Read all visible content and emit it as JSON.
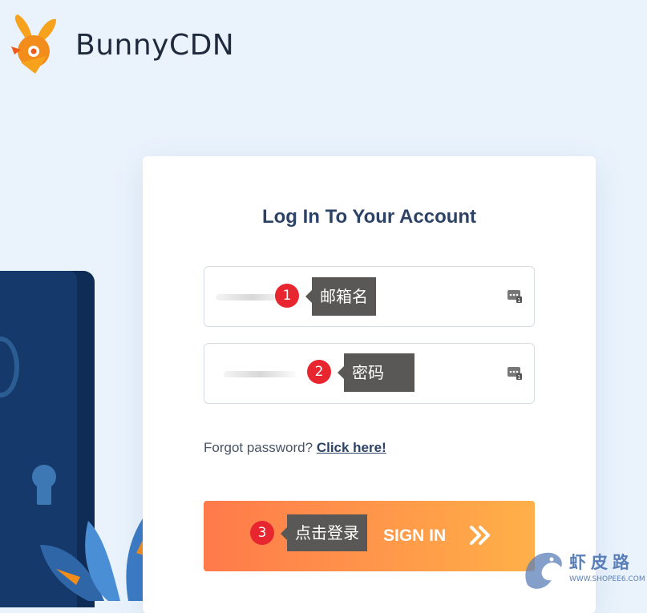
{
  "brand": {
    "name": "BunnyCDN"
  },
  "login": {
    "title": "Log In To Your Account",
    "email": {
      "value": "",
      "placeholder": ""
    },
    "password": {
      "value": "",
      "placeholder": ""
    },
    "forgot_text": "Forgot password?",
    "forgot_link": "Click here!",
    "submit_label": "SIGN IN"
  },
  "annotations": [
    {
      "number": "1",
      "label": "邮箱名"
    },
    {
      "number": "2",
      "label": "密码"
    },
    {
      "number": "3",
      "label": "点击登录"
    }
  ],
  "watermark": {
    "title": "虾皮路",
    "url": "WWW.SHOPEE6.COM"
  },
  "colors": {
    "accent": "#ff7a4a",
    "accent_end": "#ffb049",
    "title": "#2d4366",
    "badge": "#e8262f"
  },
  "icons": [
    "bunny-logo-icon",
    "password-manager-key-icon",
    "double-chevron-right-icon"
  ]
}
